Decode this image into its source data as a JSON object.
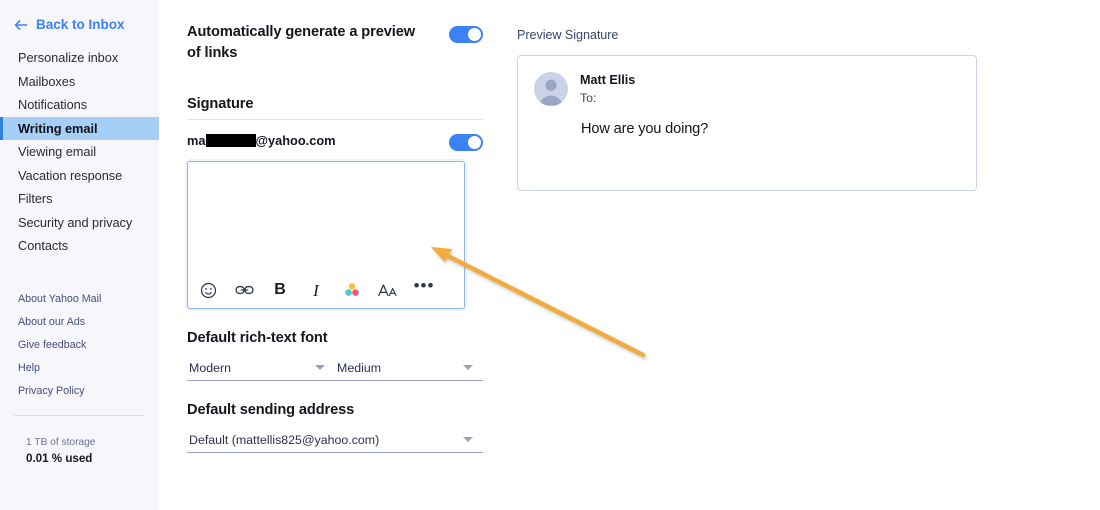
{
  "sidebar": {
    "back_link": {
      "label": "Back to Inbox",
      "icon": "arrow-left-icon"
    },
    "items": [
      {
        "label": "Personalize inbox",
        "selected": false
      },
      {
        "label": "Mailboxes",
        "selected": false
      },
      {
        "label": "Notifications",
        "selected": false
      },
      {
        "label": "Writing email",
        "selected": true
      },
      {
        "label": "Viewing email",
        "selected": false
      },
      {
        "label": "Vacation response",
        "selected": false
      },
      {
        "label": "Filters",
        "selected": false
      },
      {
        "label": "Security and privacy",
        "selected": false
      },
      {
        "label": "Contacts",
        "selected": false
      }
    ],
    "footer_links": [
      {
        "label": "About Yahoo Mail"
      },
      {
        "label": "About our Ads"
      },
      {
        "label": "Give feedback"
      },
      {
        "label": "Help"
      },
      {
        "label": "Privacy Policy"
      }
    ],
    "storage": {
      "total": "1 TB of storage",
      "used": "0.01 % used"
    }
  },
  "settings": {
    "link_preview": {
      "label": "Automatically generate a preview of links",
      "toggle_state": "on"
    },
    "signature": {
      "section_title": "Signature",
      "account_prefix": "ma",
      "account_redacted": true,
      "account_suffix": "@yahoo.com",
      "toggle_state": "on",
      "editor_value": "",
      "toolbar": [
        {
          "name": "emoji-icon",
          "label": "Emoji"
        },
        {
          "name": "link-icon",
          "label": "Insert link"
        },
        {
          "name": "bold-icon",
          "label": "B"
        },
        {
          "name": "italic-icon",
          "label": "I"
        },
        {
          "name": "text-color-icon",
          "label": "Text color"
        },
        {
          "name": "font-size-icon",
          "label": "AA"
        },
        {
          "name": "more-options-icon",
          "label": "•••"
        }
      ]
    },
    "rich_text_font": {
      "section_title": "Default rich-text font",
      "family_value": "Modern",
      "size_value": "Medium"
    },
    "sending_address": {
      "section_title": "Default sending address",
      "value": "Default (mattellis825@yahoo.com)"
    }
  },
  "preview": {
    "label": "Preview Signature",
    "from": "Matt Ellis",
    "to": "To:",
    "body": "How are you doing?"
  },
  "colors": {
    "accent_blue": "#3b82f6",
    "selected_nav_bg": "#a6cff8",
    "selected_nav_bar": "#2f7fe0",
    "annotation_orange": "#f0ad3c",
    "palette_yellow": "#f5c243",
    "palette_teal": "#57c8cf",
    "palette_pink": "#ef5b72",
    "sidebar_bg": "#f6f6fb"
  },
  "annotation": {
    "type": "arrow",
    "points_to": "signature-editor",
    "color": "#f0ad3c"
  }
}
